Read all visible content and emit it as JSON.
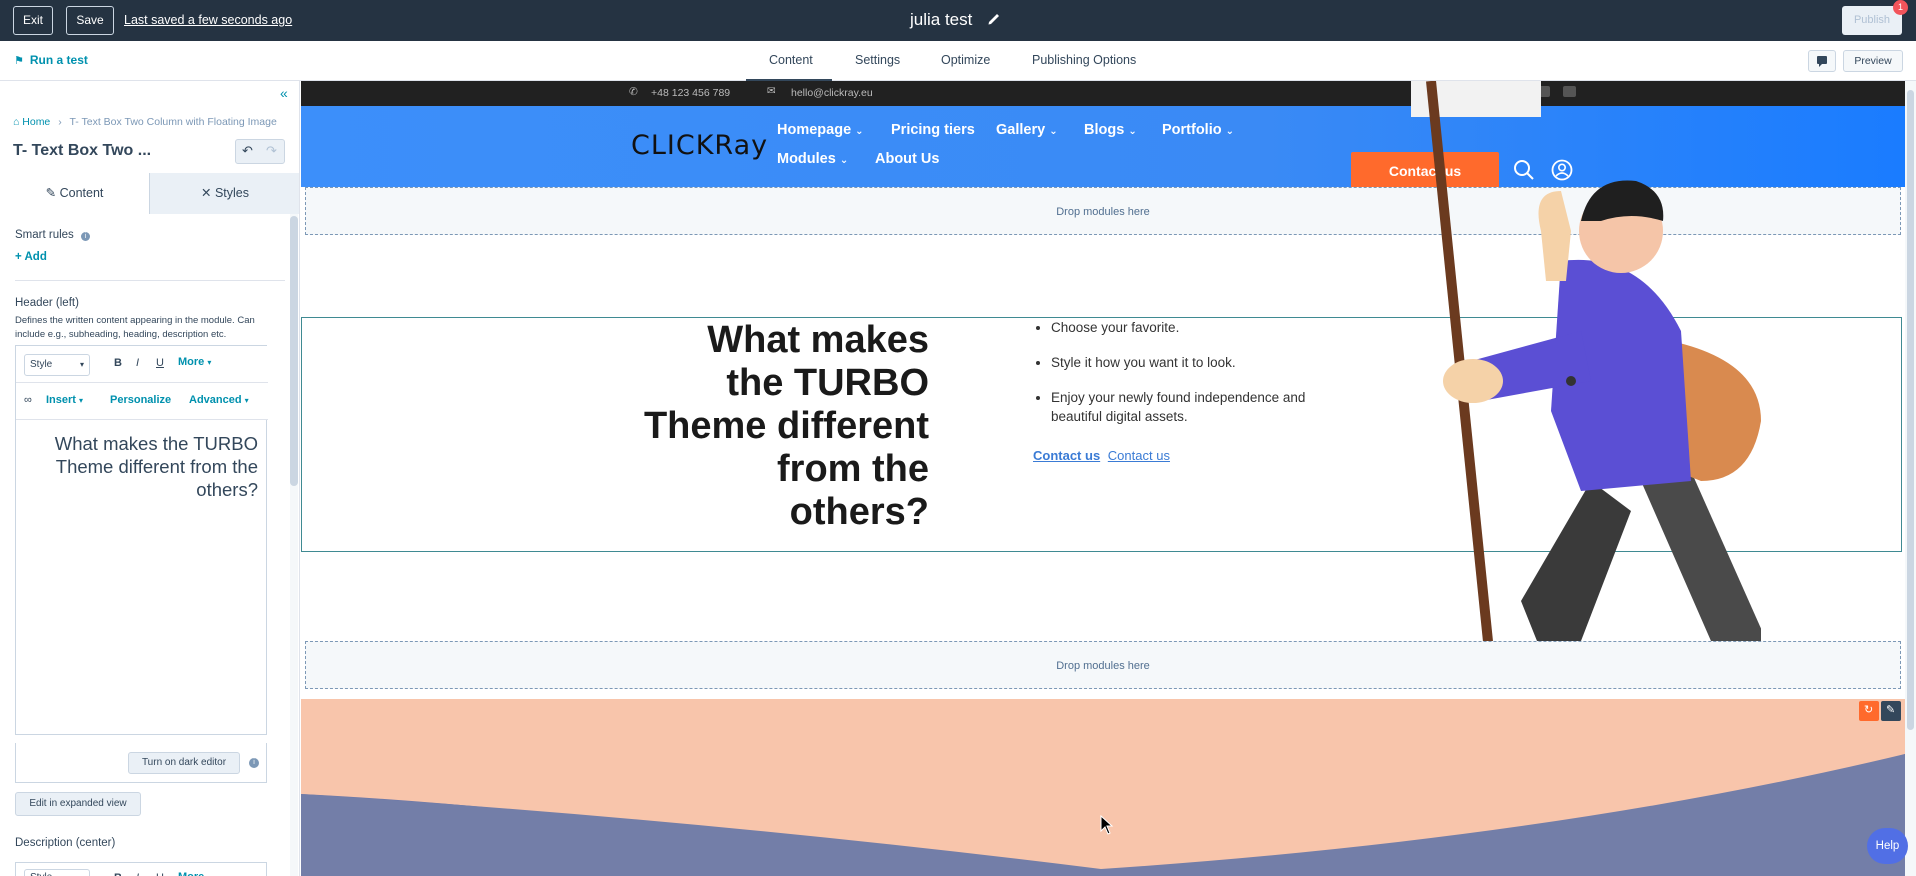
{
  "topbar": {
    "exit_label": "Exit",
    "save_label": "Save",
    "last_saved": "Last saved a few seconds ago",
    "title": "julia test",
    "publish_label": "Publish",
    "publish_badge": "1"
  },
  "navbar": {
    "run_test": "Run a test",
    "tabs": [
      "Content",
      "Settings",
      "Optimize",
      "Publishing Options"
    ],
    "preview_label": "Preview"
  },
  "sidebar": {
    "breadcrumb_home": "Home",
    "breadcrumb_current": "T- Text Box Two Column with Floating Image",
    "module_title": "T- Text Box Two ...",
    "tab_content": "Content",
    "tab_styles": "Styles",
    "smart_rules_label": "Smart rules",
    "add_label": "Add",
    "header_left_label": "Header (left)",
    "header_left_help": "Defines the written content appearing in the module. Can include e.g., subheading, heading, description etc.",
    "toolbar": {
      "style": "Style",
      "bold": "B",
      "italic": "I",
      "underline": "U",
      "more": "More",
      "insert": "Insert",
      "personalize": "Personalize",
      "advanced": "Advanced"
    },
    "editor_text": "What makes the TURBO Theme different from the others?",
    "dark_editor_label": "Turn on dark editor",
    "expanded_view_label": "Edit in expanded view",
    "description_center_label": "Description (center)"
  },
  "site": {
    "phone": "+48 123 456 789",
    "email": "hello@clickray.eu",
    "logo": "CLICKRay",
    "nav": [
      "Homepage",
      "Pricing tiers",
      "Gallery",
      "Blogs",
      "Portfolio",
      "Modules",
      "About Us"
    ],
    "contact_button": "Contact us",
    "dropzone_label": "Drop modules here",
    "headline": "What makes the TURBO Theme different from the others?",
    "bullets": [
      "Choose your favorite.",
      "Style it how you want it to look.",
      "Enjoy your newly found independence and beautiful digital assets."
    ],
    "link_bold": "Contact us",
    "link_plain": "Contact us"
  },
  "help_label": "Help",
  "colors": {
    "topbar": "#253342",
    "accent": "#0091ae",
    "site_blue": "#3c8ffa",
    "orange": "#ff6a2c",
    "peach": "#f8c5ab"
  }
}
